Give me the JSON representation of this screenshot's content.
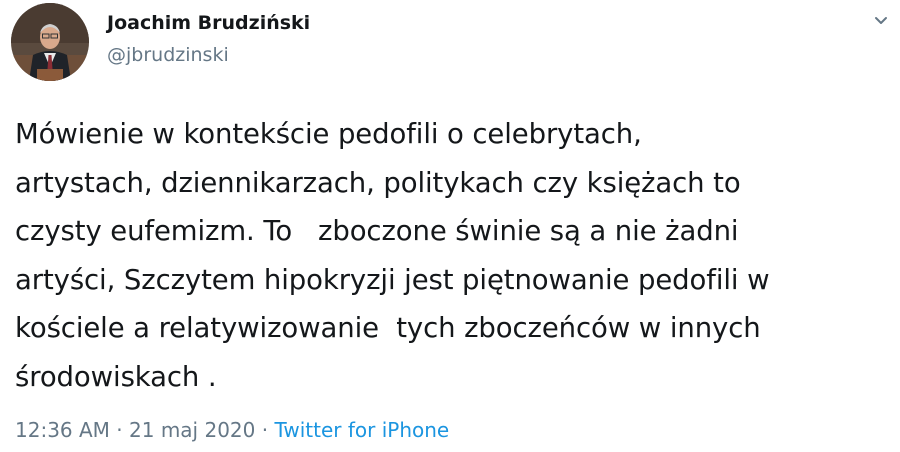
{
  "author": {
    "display_name": "Joachim Brudziński",
    "handle": "@jbrudzinski",
    "avatar_icon": "user-avatar-photo"
  },
  "menu": {
    "icon": "chevron-down-icon"
  },
  "tweet": {
    "lines": [
      "Mówienie w kontekście pedofili o celebrytach,",
      "artystach, dziennikarzach, politykach czy księżach to",
      "czysty eufemizm. To   zboczone świnie są a nie żadni",
      "artyści, Szczytem hipokryzji jest piętnowanie pedofili w",
      "kościele a relatywizowanie  tych zboczeńców w innych",
      "środowiskach ."
    ]
  },
  "meta": {
    "time": "12:36 AM",
    "separator": " · ",
    "date": "21 maj 2020",
    "source": "Twitter for iPhone"
  },
  "colors": {
    "text": "#14171a",
    "secondary": "#657786",
    "link": "#1b95e0"
  }
}
